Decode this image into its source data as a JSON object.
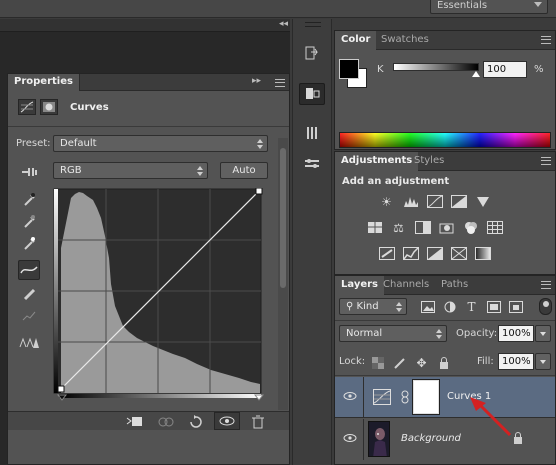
{
  "topbar": {
    "workspace": "Essentials",
    "collapse": "◂◂"
  },
  "properties": {
    "tab": "Properties",
    "adjustment_title": "Curves",
    "preset_label": "Preset:",
    "preset_value": "Default",
    "channel_value": "RGB",
    "auto_label": "Auto",
    "tools": [
      "on-image-adjust-icon",
      "sample-black-eyedropper-icon",
      "sample-gray-eyedropper-icon",
      "sample-white-eyedropper-icon",
      "edit-points-curve-icon",
      "draw-pencil-icon",
      "smooth-curve-icon",
      "clipping-warning-icon"
    ],
    "footer_icons": [
      "clip-to-layer-icon",
      "view-previous-state-icon",
      "reset-defaults-icon",
      "toggle-visibility-icon",
      "delete-layer-icon"
    ]
  },
  "color": {
    "tabs": [
      "Color",
      "Swatches"
    ],
    "channel": "K",
    "value": "100",
    "unit": "%",
    "slider_fraction": 1.0
  },
  "adjustments": {
    "tabs": [
      "Adjustments",
      "Styles"
    ],
    "heading": "Add an adjustment",
    "rows": [
      [
        "brightness-contrast-icon",
        "levels-icon",
        "curves-icon",
        "exposure-icon",
        "vibrance-icon"
      ],
      [
        "hue-saturation-icon",
        "color-balance-icon",
        "black-white-icon",
        "photo-filter-icon",
        "channel-mixer-icon",
        "color-lookup-icon"
      ],
      [
        "invert-icon",
        "posterize-icon",
        "threshold-icon",
        "selective-color-icon",
        "gradient-map-icon"
      ]
    ]
  },
  "layers": {
    "tabs": [
      "Layers",
      "Channels",
      "Paths"
    ],
    "filter_kind": "Kind",
    "blend_mode": "Normal",
    "opacity_label": "Opacity:",
    "opacity_value": "100%",
    "lock_label": "Lock:",
    "fill_label": "Fill:",
    "fill_value": "100%",
    "items": [
      {
        "name": "Curves 1",
        "selected": true
      },
      {
        "name": "Background",
        "selected": false,
        "locked": true
      }
    ]
  },
  "colors": {
    "accent_arrow": "#d42121",
    "selected_layer": "#5a6a80"
  }
}
